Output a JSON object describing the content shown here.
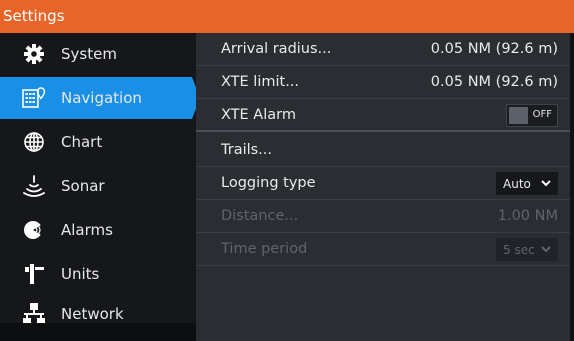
{
  "window": {
    "title": "Settings"
  },
  "sidebar": {
    "items": [
      {
        "label": "System",
        "icon": "gear-icon"
      },
      {
        "label": "Navigation",
        "icon": "navigation-icon",
        "active": true
      },
      {
        "label": "Chart",
        "icon": "globe-icon"
      },
      {
        "label": "Sonar",
        "icon": "sonar-icon"
      },
      {
        "label": "Alarms",
        "icon": "alarm-icon"
      },
      {
        "label": "Units",
        "icon": "units-icon"
      },
      {
        "label": "Network",
        "icon": "network-icon"
      }
    ]
  },
  "settings": {
    "arrival_radius": {
      "label": "Arrival radius...",
      "value": "0.05 NM (92.6 m)"
    },
    "xte_limit": {
      "label": "XTE limit...",
      "value": "0.05 NM (92.6 m)"
    },
    "xte_alarm": {
      "label": "XTE Alarm",
      "toggle_text": "OFF"
    },
    "trails": {
      "label": "Trails..."
    },
    "logging_type": {
      "label": "Logging type",
      "value": "Auto"
    },
    "distance": {
      "label": "Distance...",
      "value": "1.00 NM"
    },
    "time_period": {
      "label": "Time period",
      "value": "5 sec"
    }
  },
  "colors": {
    "accent": "#e8652a",
    "active_item": "#1a8fe6",
    "sidebar_bg": "#15171a",
    "panel_bg": "#2a2d32"
  }
}
